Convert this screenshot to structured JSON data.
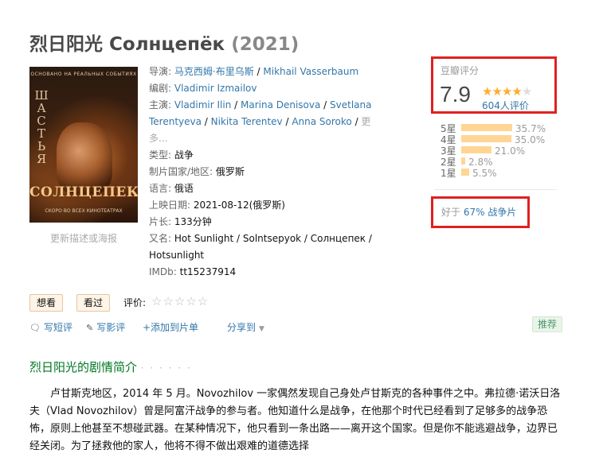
{
  "title": {
    "name": "烈日阳光 Солнцепёк",
    "year": "(2021)"
  },
  "poster": {
    "top_text": "ОСНОВАНО НА РЕАЛЬНЫХ СОБЫТИЯХ",
    "vertical_text": "ШАСТЬЯ",
    "big_text": "СОЛНЦЕПЕК",
    "bottom_text": "СКОРО ВО ВСЕХ КИНОТЕАТРАХ",
    "update_link": "更新描述或海报"
  },
  "info": {
    "director_label": "导演:",
    "director_1": "马克西姆·布里乌斯",
    "director_2": "Mikhail Vasserbaum",
    "writer_label": "编剧:",
    "writer_1": "Vladimir Izmailov",
    "cast_label": "主演:",
    "cast_1": "Vladimir Ilin",
    "cast_2": "Marina Denisova",
    "cast_3": "Svetlana Terentyeva",
    "cast_4": "Nikita Terentev",
    "cast_5": "Anna Soroko",
    "cast_more": "更多...",
    "genre_label": "类型:",
    "genre": "战争",
    "country_label": "制片国家/地区:",
    "country": "俄罗斯",
    "language_label": "语言:",
    "language": "俄语",
    "release_label": "上映日期:",
    "release": "2021-08-12(俄罗斯)",
    "runtime_label": "片长:",
    "runtime": "133分钟",
    "aka_label": "又名:",
    "aka": "Hot Sunlight / Solntsepyok / Солнцепек / Hotsunlight",
    "imdb_label": "IMDb:",
    "imdb": "tt15237914"
  },
  "rating": {
    "label": "豆瓣评分",
    "score": "7.9",
    "stars_filled": 4,
    "count": "604人评价",
    "distribution": [
      {
        "label": "5星",
        "pct": "35.7%",
        "value": 35.7
      },
      {
        "label": "4星",
        "pct": "35.0%",
        "value": 35.0
      },
      {
        "label": "3星",
        "pct": "21.0%",
        "value": 21.0
      },
      {
        "label": "2星",
        "pct": "2.8%",
        "value": 2.8
      },
      {
        "label": "1星",
        "pct": "5.5%",
        "value": 5.5
      }
    ],
    "better_prefix": "好于",
    "better_link": "67% 战争片"
  },
  "actions": {
    "want": "想看",
    "seen": "看过",
    "rate_label": "评价:",
    "rate_stars": "☆☆☆☆☆",
    "write_short": "写短评",
    "write_review": "写影评",
    "add_list": "+添加到片单",
    "share": "分享到",
    "recommend": "推荐"
  },
  "summary": {
    "title": "烈日阳光的剧情简介",
    "dots": "· · · · · ·",
    "text": "卢甘斯克地区，2014 年 5 月。Novozhilov 一家偶然发现自己身处卢甘斯克的各种事件之中。弗拉德·诺沃日洛夫（Vlad Novozhilov）曾是阿富汗战争的参与者。他知道什么是战争，在他那个时代已经看到了足够多的战争恐怖，原则上他甚至不想碰武器。在某种情况下，他只看到一条出路——离开这个国家。但是你不能逃避战争，边界已经关闭。为了拯救他的家人，他将不得不做出艰难的道德选择"
  },
  "colors": {
    "link": "#3377aa",
    "star": "#ffac2d",
    "bar": "#ffd596",
    "highlight_border": "#e02020",
    "summary_title": "#007722"
  }
}
